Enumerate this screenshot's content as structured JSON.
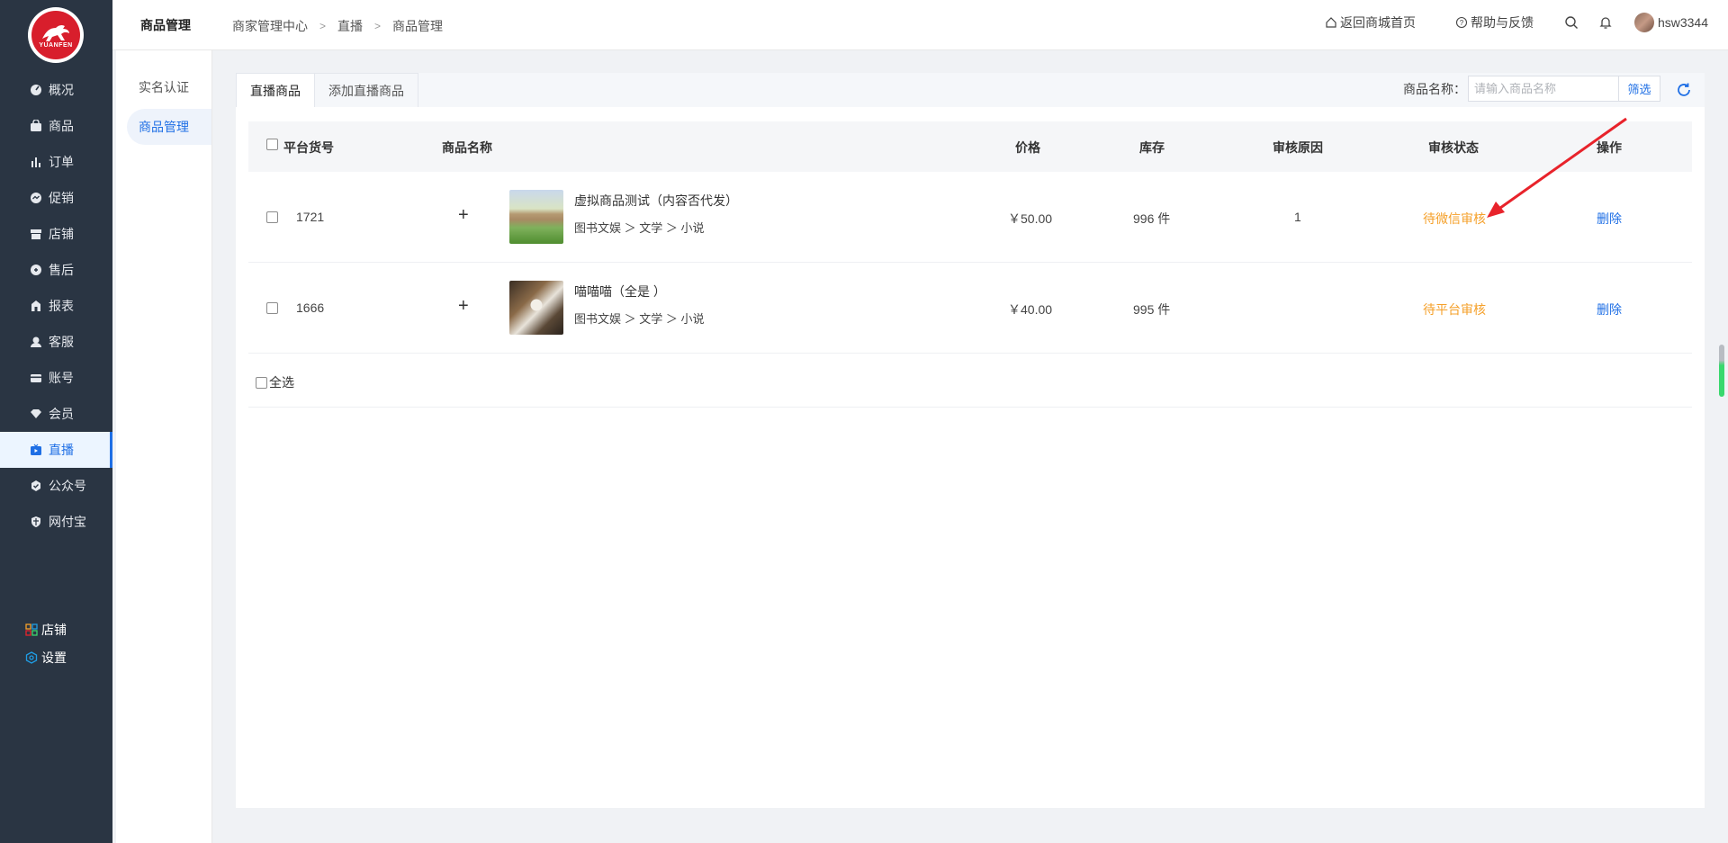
{
  "brand": {
    "logo_text": "YUANFEN"
  },
  "sidebar": {
    "items": [
      {
        "label": "概况",
        "icon": "dashboard-icon"
      },
      {
        "label": "商品",
        "icon": "bag-icon"
      },
      {
        "label": "订单",
        "icon": "bar-chart-icon"
      },
      {
        "label": "促销",
        "icon": "promo-icon"
      },
      {
        "label": "店铺",
        "icon": "store-icon"
      },
      {
        "label": "售后",
        "icon": "after-sales-icon"
      },
      {
        "label": "报表",
        "icon": "report-icon"
      },
      {
        "label": "客服",
        "icon": "customer-service-icon"
      },
      {
        "label": "账号",
        "icon": "card-icon"
      },
      {
        "label": "会员",
        "icon": "diamond-icon"
      },
      {
        "label": "直播",
        "icon": "live-tv-icon",
        "active": true
      },
      {
        "label": "公众号",
        "icon": "check-badge-icon"
      },
      {
        "label": "网付宝",
        "icon": "shield-icon"
      }
    ],
    "bottom": [
      {
        "label": "店铺",
        "icon": "grid-icon"
      },
      {
        "label": "设置",
        "icon": "hex-gear-icon"
      }
    ]
  },
  "submenu": {
    "items": [
      {
        "label": "实名认证"
      },
      {
        "label": "商品管理",
        "active": true
      }
    ]
  },
  "header": {
    "title": "商品管理",
    "breadcrumb": [
      "商家管理中心",
      "直播",
      "商品管理"
    ],
    "back_home": "返回商城首页",
    "help": "帮助与反馈",
    "username": "hsw3344"
  },
  "tabs": [
    {
      "label": "直播商品",
      "active": true
    },
    {
      "label": "添加直播商品"
    }
  ],
  "filter": {
    "label": "商品名称：",
    "placeholder": "请输入商品名称",
    "button": "筛选"
  },
  "table": {
    "columns": [
      "平台货号",
      "商品名称",
      "价格",
      "库存",
      "审核原因",
      "审核状态",
      "操作"
    ],
    "rows": [
      {
        "sku": "1721",
        "name": "虚拟商品测试（内容否代发）",
        "category": "图书文娱 ＞ 文学 ＞ 小说",
        "price": "￥50.00",
        "stock": "996 件",
        "reason": "1",
        "status": "待微信审核",
        "action": "删除"
      },
      {
        "sku": "1666",
        "name": "喵喵喵（全是 ）",
        "category": "图书文娱 ＞ 文学 ＞ 小说",
        "price": "￥40.00",
        "stock": "995 件",
        "reason": "",
        "status": "待平台审核",
        "action": "删除"
      }
    ],
    "select_all": "全选"
  },
  "colors": {
    "sidebar_bg": "#2a3543",
    "accent": "#1f6fe5",
    "status_orange": "#f5a02a",
    "annotation_red": "#e8232b"
  }
}
